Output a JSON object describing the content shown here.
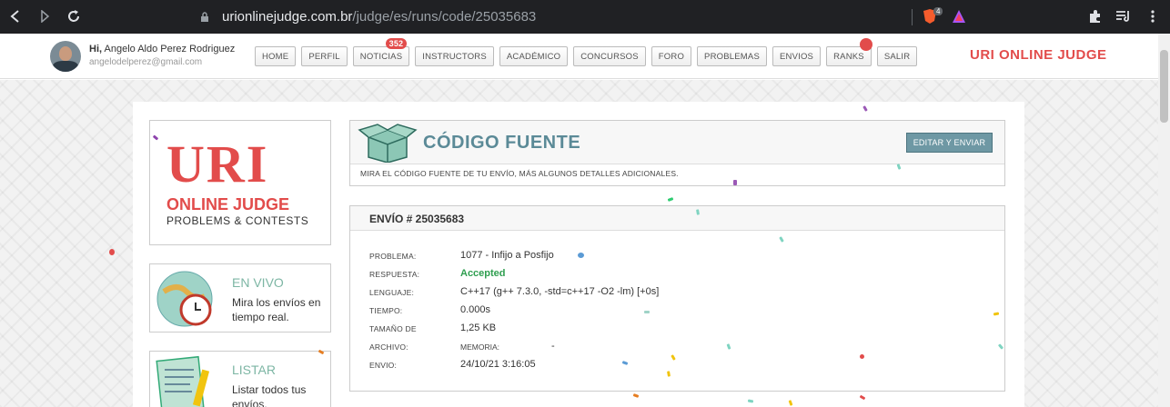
{
  "browser": {
    "url_host": "urionlinejudge.com.br",
    "url_path": "/judge/es/runs/code/25035683",
    "brave_badge": "4"
  },
  "header": {
    "greeting": "Hi,",
    "user_name": "Angelo Aldo Perez Rodriguez",
    "user_email": "angelodelperez@gmail.com",
    "brand": "URI ONLINE JUDGE",
    "menu": [
      {
        "label": "HOME"
      },
      {
        "label": "PERFIL"
      },
      {
        "label": "NOTICIAS",
        "badge": "352"
      },
      {
        "label": "INSTRUCTORS"
      },
      {
        "label": "ACADÉMICO"
      },
      {
        "label": "CONCURSOS"
      },
      {
        "label": "FORO"
      },
      {
        "label": "PROBLEMAS"
      },
      {
        "label": "ENVIOS"
      },
      {
        "label": "RANKS"
      },
      {
        "label": "SALIR"
      }
    ]
  },
  "sidebar": {
    "logo_uri": "URI",
    "logo_oj": "ONLINE JUDGE",
    "logo_pc": "PROBLEMS & CONTESTS",
    "cards": [
      {
        "title": "EN VIVO",
        "text": "Mira los envíos en tiempo real."
      },
      {
        "title": "LISTAR",
        "text": "Listar todos tus envíos."
      }
    ]
  },
  "source_panel": {
    "title": "CÓDIGO FUENTE",
    "button": "EDITAR Y ENVIAR",
    "subtitle": "MIRA EL CÓDIGO FUENTE DE TU ENVÍO, MÁS ALGUNOS DETALLES ADICIONALES."
  },
  "run_panel": {
    "heading": "ENVÍO # 25035683",
    "problema_label": "PROBLEMA:",
    "problema_value": "1077 - Infijo a Posfijo",
    "respuesta_label": "RESPUESTA:",
    "respuesta_value": "Accepted",
    "lenguaje_label": "LENGUAJE:",
    "lenguaje_value": "C++17 (g++ 7.3.0, -std=c++17 -O2 -lm) [+0s]",
    "tiempo_label": "TIEMPO:",
    "tiempo_value": "0.000s",
    "tamano_label": "TAMAÑO DE",
    "tamano_value": "1,25 KB",
    "archivo_label": "ARCHIVO:",
    "memoria_label": "MEMORIA:",
    "memoria_value": "-",
    "envio_label": "ENVIO:",
    "envio_value": "24/10/21 3:16:05"
  },
  "colors": {
    "brand_red": "#e24c4b",
    "accepted_green": "#2e9e4f",
    "teal": "#5b8a97"
  }
}
